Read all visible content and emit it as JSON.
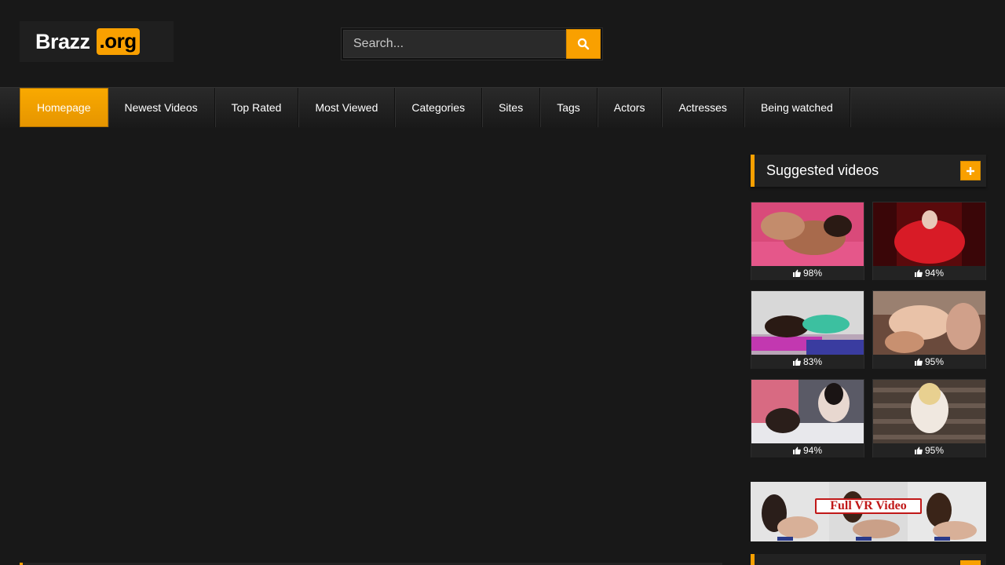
{
  "logo": {
    "text": "Brazz",
    "badge": ".org"
  },
  "search": {
    "placeholder": "Search..."
  },
  "nav": {
    "items": [
      {
        "label": "Homepage",
        "active": true
      },
      {
        "label": "Newest Videos"
      },
      {
        "label": "Top Rated"
      },
      {
        "label": "Most Viewed"
      },
      {
        "label": "Categories"
      },
      {
        "label": "Sites"
      },
      {
        "label": "Tags"
      },
      {
        "label": "Actors"
      },
      {
        "label": "Actresses"
      },
      {
        "label": "Being watched"
      }
    ]
  },
  "sidebar": {
    "title": "Suggested videos",
    "videos": [
      {
        "rating": "98%"
      },
      {
        "rating": "94%"
      },
      {
        "rating": "83%"
      },
      {
        "rating": "95%"
      },
      {
        "rating": "94%"
      },
      {
        "rating": "95%"
      }
    ],
    "banner_text": "Full VR Video"
  },
  "colors": {
    "accent": "#f9a000",
    "background": "#181818"
  }
}
